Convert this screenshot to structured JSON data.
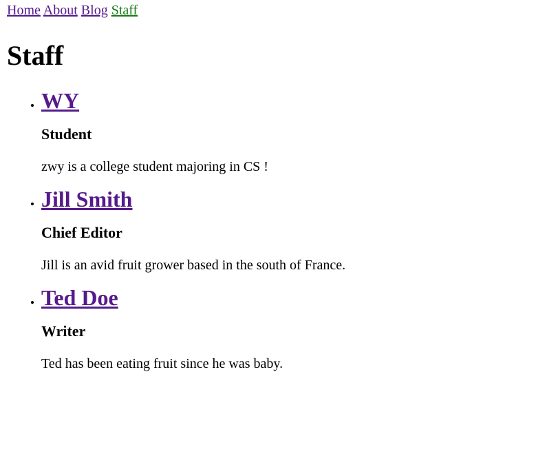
{
  "nav": {
    "items": [
      {
        "label": "Home"
      },
      {
        "label": "About"
      },
      {
        "label": "Blog"
      },
      {
        "label": "Staff"
      }
    ]
  },
  "page": {
    "title": "Staff"
  },
  "staff": [
    {
      "name": "WY",
      "role": "Student",
      "bio": "zwy is a college student majoring in CS !"
    },
    {
      "name": "Jill Smith",
      "role": "Chief Editor",
      "bio": "Jill is an avid fruit grower based in the south of France."
    },
    {
      "name": "Ted Doe",
      "role": "Writer",
      "bio": "Ted has been eating fruit since he was baby."
    }
  ],
  "colors": {
    "visited_link": "#551a8b",
    "active_nav_link": "#1a7a1a",
    "text": "#000000",
    "background": "#ffffff"
  }
}
